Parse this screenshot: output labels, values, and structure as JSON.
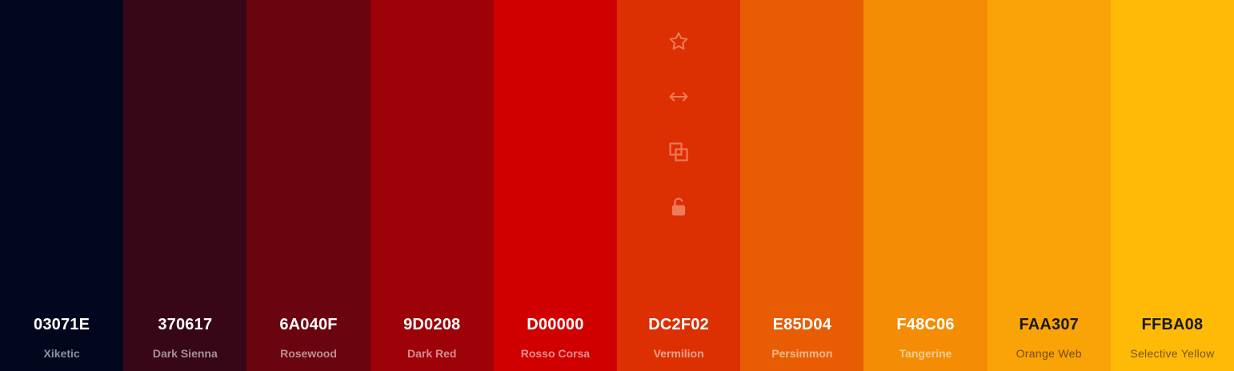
{
  "palette": {
    "swatches": [
      {
        "hex": "03071E",
        "name": "Xiketic",
        "color": "#03071E",
        "text_tone": "light"
      },
      {
        "hex": "370617",
        "name": "Dark Sienna",
        "color": "#370617",
        "text_tone": "light"
      },
      {
        "hex": "6A040F",
        "name": "Rosewood",
        "color": "#6A040F",
        "text_tone": "light"
      },
      {
        "hex": "9D0208",
        "name": "Dark Red",
        "color": "#9D0208",
        "text_tone": "light"
      },
      {
        "hex": "D00000",
        "name": "Rosso Corsa",
        "color": "#D00000",
        "text_tone": "light"
      },
      {
        "hex": "DC2F02",
        "name": "Vermilion",
        "color": "#DC2F02",
        "text_tone": "light"
      },
      {
        "hex": "E85D04",
        "name": "Persimmon",
        "color": "#E85D04",
        "text_tone": "light"
      },
      {
        "hex": "F48C06",
        "name": "Tangerine",
        "color": "#F48C06",
        "text_tone": "light"
      },
      {
        "hex": "FAA307",
        "name": "Orange Web",
        "color": "#FAA307",
        "text_tone": "dark"
      },
      {
        "hex": "FFBA08",
        "name": "Selective Yellow",
        "color": "#FFBA08",
        "text_tone": "dark"
      }
    ],
    "hovered_swatch_index": 5,
    "hover_tools": [
      {
        "icon": "star-icon",
        "action": "favorite"
      },
      {
        "icon": "arrows-horizontal-icon",
        "action": "drag"
      },
      {
        "icon": "copy-icon",
        "action": "copy"
      },
      {
        "icon": "unlock-icon",
        "action": "lock"
      }
    ],
    "tool_icon_color": "#F07A5C"
  }
}
